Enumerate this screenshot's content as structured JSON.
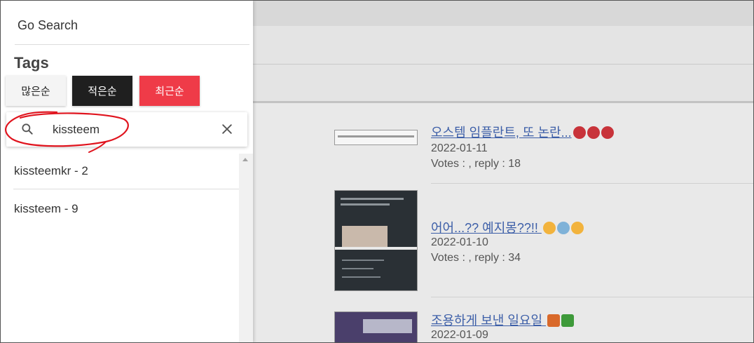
{
  "drawer": {
    "go_search": "Go Search",
    "tags_heading": "Tags",
    "sort_buttons": {
      "most": "많은순",
      "least": "적은순",
      "recent": "최근순"
    },
    "search": {
      "value": "kissteem"
    },
    "results": [
      {
        "label": "kissteemkr - 2"
      },
      {
        "label": "kissteem - 9"
      }
    ]
  },
  "posts": [
    {
      "title": "오스템 임플란트, 또 논란...",
      "date": "2022-01-11",
      "meta": "Votes : , reply : 18",
      "emoji_icons": [
        "angry-face-icon",
        "angry-face-icon",
        "angry-face-icon"
      ]
    },
    {
      "title": "어어...?? 예지몽??!! ",
      "date": "2022-01-10",
      "meta": "Votes : , reply : 34",
      "emoji_icons": [
        "frowning-face-icon",
        "fearful-face-icon",
        "screaming-face-icon"
      ]
    },
    {
      "title": "조용하게 보낸 일요일 ",
      "date": "2022-01-09",
      "emoji_icons": [
        "fallen-leaf-icon",
        "four-leaf-clover-icon"
      ]
    }
  ],
  "colors": {
    "accent_red": "#ef3b48",
    "dark_button": "#1f1f1f",
    "link_blue": "#3d5fa8",
    "annotation_red": "#e0141e"
  }
}
